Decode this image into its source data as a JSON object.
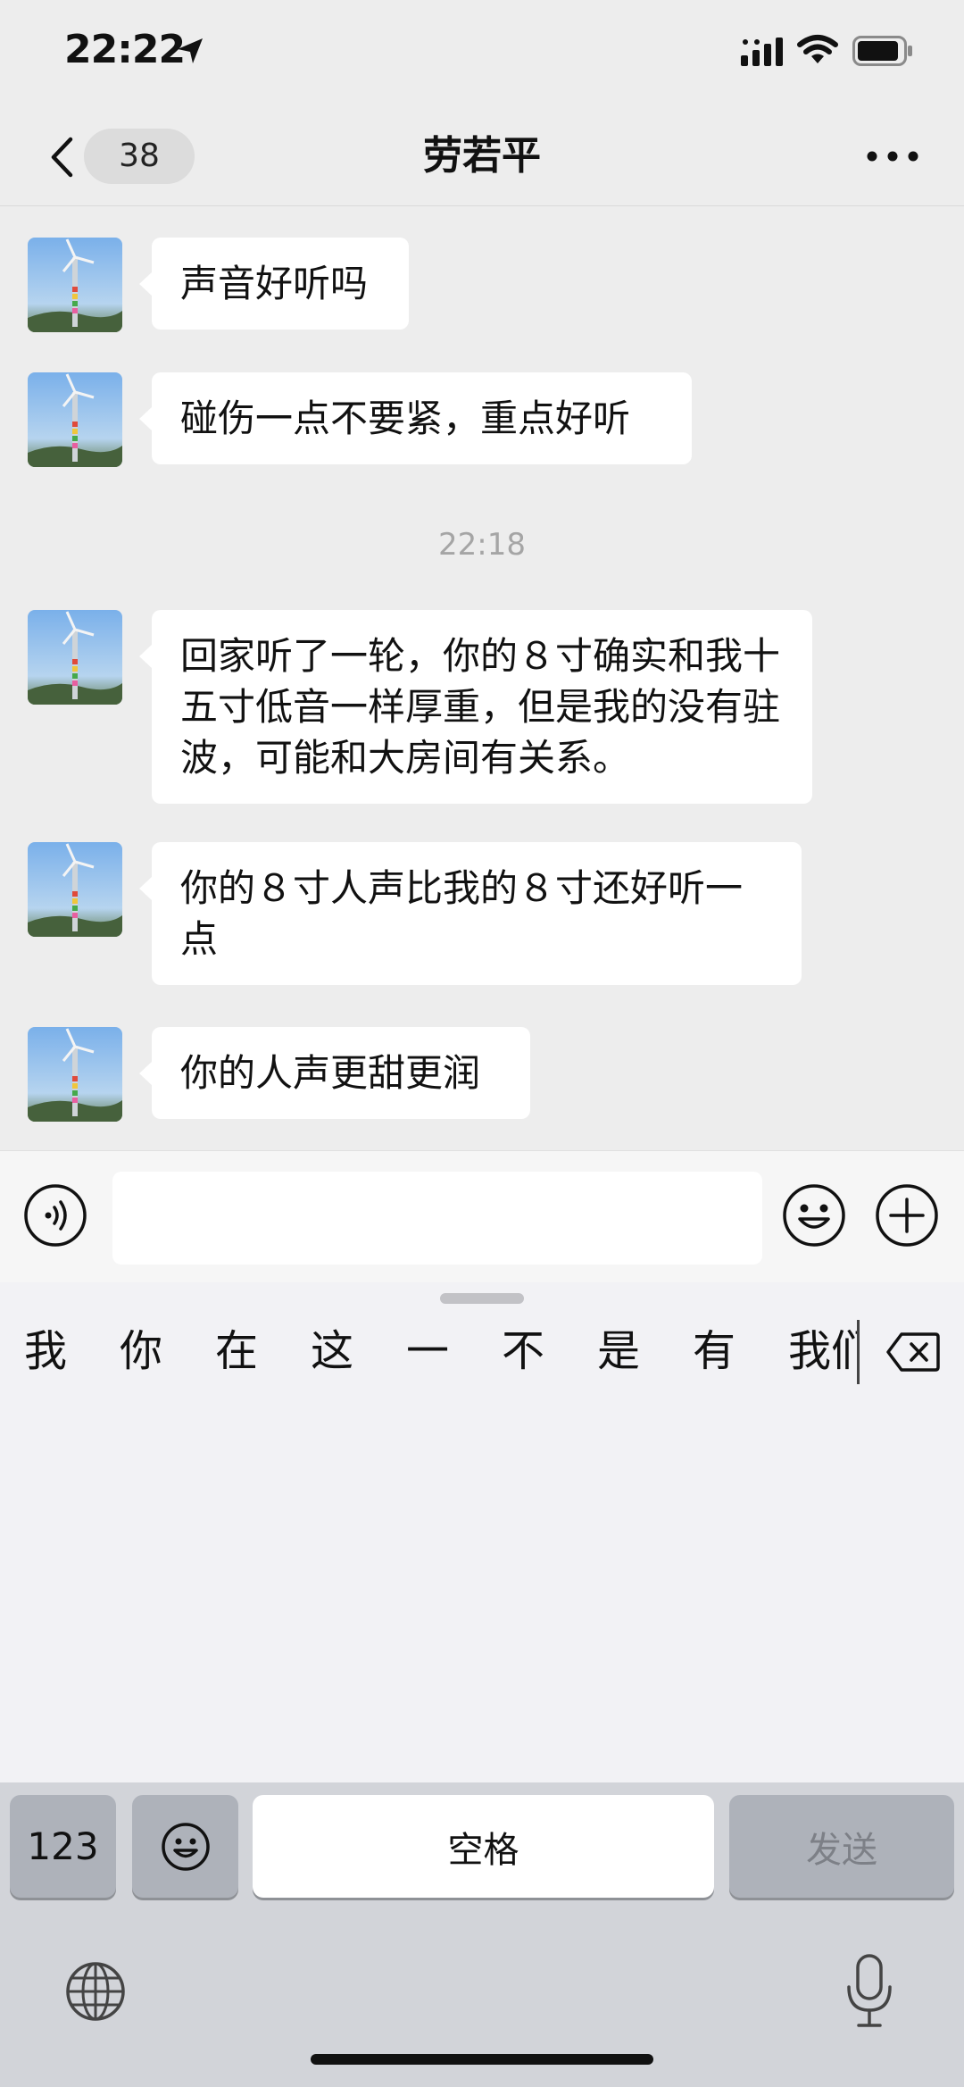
{
  "status_bar": {
    "time": "22:22"
  },
  "nav": {
    "unread_count": "38",
    "title": "劳若平"
  },
  "messages": [
    {
      "text": "声音好听吗"
    },
    {
      "text": "碰伤一点不要紧，重点好听"
    },
    {
      "text": "回家听了一轮，你的８寸确实和我十五寸低音一样厚重，但是我的没有驻波，可能和大房间有关系。"
    },
    {
      "text": "你的８寸人声比我的８寸还好听一点"
    },
    {
      "text": "你的人声更甜更润"
    }
  ],
  "time_divider": "22:18",
  "input": {
    "value": ""
  },
  "candidates": [
    "我",
    "你",
    "在",
    "这",
    "一",
    "不",
    "是",
    "有",
    "我们"
  ],
  "keyboard": {
    "numbers_label": "123",
    "space_label": "空格",
    "send_label": "发送"
  },
  "icons": {
    "status": [
      "location-arrow-icon",
      "signal-icon",
      "wifi-icon",
      "battery-icon"
    ],
    "input_bar": [
      "voice-icon",
      "emoji-icon",
      "plus-icon"
    ],
    "keyboard": [
      "delete-icon",
      "emoji-icon",
      "globe-icon",
      "mic-icon"
    ]
  }
}
